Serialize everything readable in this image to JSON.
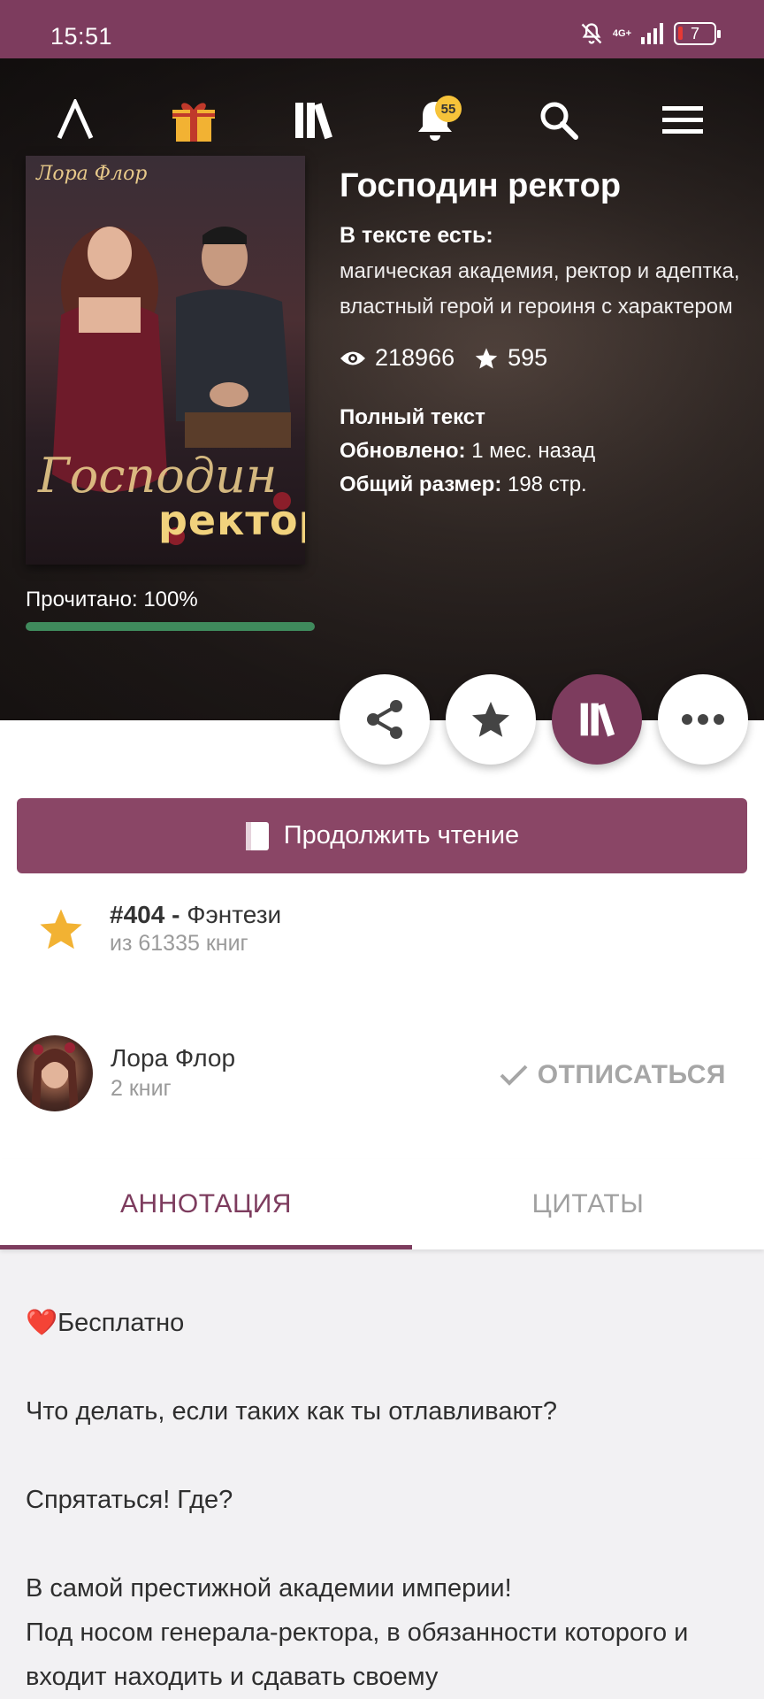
{
  "status_bar": {
    "time": "15:51",
    "network": "4G+",
    "battery": "7"
  },
  "nav": {
    "logo_icon": "litnet-logo-icon",
    "gift_icon": "gift-icon",
    "library_icon": "library-icon",
    "notifications_count": "55",
    "search_icon": "search-icon",
    "menu_icon": "hamburger-menu-icon"
  },
  "cover": {
    "author_text": "Лора Флор",
    "title_line1": "Господин",
    "title_line2": "ректор"
  },
  "reading": {
    "label": "Прочитано: 100%",
    "progress": 1.0
  },
  "book": {
    "title": "Господин ректор",
    "tags_label": "В тексте есть:",
    "tags": "магическая академия, ректор и адептка, властный герой и героиня с характером",
    "views": "218966",
    "likes": "595",
    "status": "Полный текст",
    "updated_label": "Обновлено:",
    "updated_value": "1 мес. назад",
    "size_label": "Общий размер:",
    "size_value": "198 стр."
  },
  "actions": {
    "share_icon": "share-icon",
    "favorite_icon": "star-icon",
    "library_icon": "library-icon",
    "more_icon": "more-icon"
  },
  "continue_button": {
    "label": "Продолжить чтение"
  },
  "rank": {
    "number": "#404 -",
    "genre": "Фэнтези",
    "of_total": "из 61335 книг"
  },
  "author": {
    "name": "Лора Флор",
    "books": "2 книг",
    "unsubscribe_label": "ОТПИСАТЬСЯ"
  },
  "tabs": [
    {
      "label": "АННОТАЦИЯ",
      "active": true
    },
    {
      "label": "ЦИТАТЫ",
      "active": false
    }
  ],
  "annotation": {
    "p1": "❤️Бесплатно",
    "p2": "Что делать, если таких как ты отлавливают?",
    "p3": "Спрятаться! Где?",
    "p4": "В самой престижной академии империи!",
    "p5": "Под носом генерала-ректора, в обязанности которого и входит находить и сдавать своему"
  },
  "colors": {
    "brand": "#7d3c5e",
    "button": "#8a4666",
    "progress": "#3f8a5c",
    "star": "#f2b233"
  }
}
